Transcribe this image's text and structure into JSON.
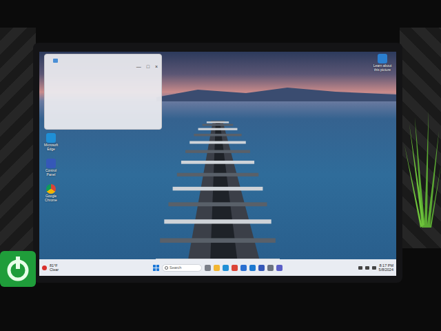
{
  "window": {
    "controls": [
      "—",
      "□",
      "×"
    ]
  },
  "desktop_icons": [
    {
      "label": "Microsoft Edge"
    },
    {
      "label": "Control Panel"
    },
    {
      "label": "Google Chrome"
    }
  ],
  "spotlight": {
    "label": "Learn about this picture"
  },
  "taskbar": {
    "weather": {
      "temp": "81°F",
      "condition": "Clear"
    },
    "search": {
      "placeholder": "Search"
    },
    "clock": {
      "time": "8:17 PM",
      "date": "5/8/2024"
    }
  }
}
